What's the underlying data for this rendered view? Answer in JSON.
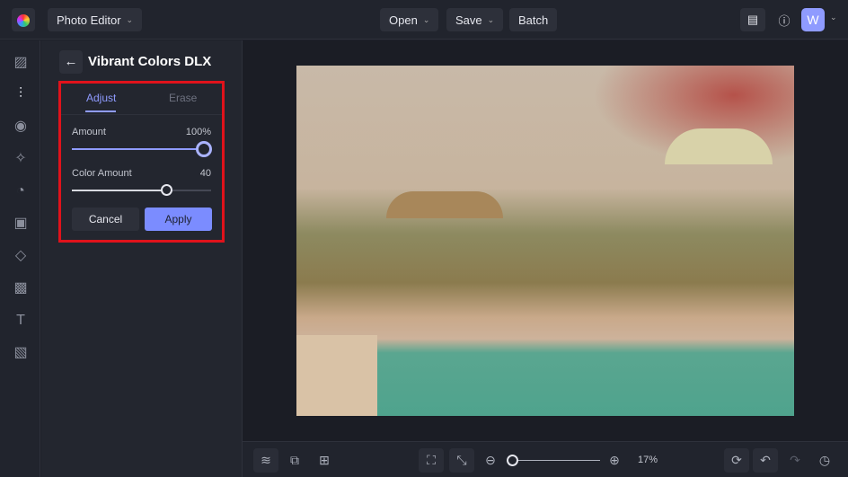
{
  "topbar": {
    "app_menu": "Photo Editor",
    "open": "Open",
    "save": "Save",
    "batch": "Batch",
    "avatar": "W"
  },
  "panel": {
    "title": "Vibrant Colors DLX",
    "tabs": [
      "Adjust",
      "Erase"
    ],
    "amount": {
      "label": "Amount",
      "value": "100%",
      "fraction": 1.0
    },
    "color_amount": {
      "label": "Color Amount",
      "value": "40",
      "fraction": 0.66
    },
    "cancel": "Cancel",
    "apply": "Apply"
  },
  "bottom": {
    "zoom": "17%",
    "zoom_fraction": 0.0
  },
  "colors": {
    "accent": "#7b8cff",
    "highlight": "#e0121b"
  }
}
